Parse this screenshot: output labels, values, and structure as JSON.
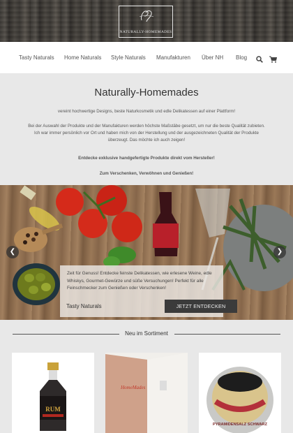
{
  "logo": {
    "text": "NATURALLY-HOMEMADES"
  },
  "nav": {
    "items": [
      "Tasty Naturals",
      "Home Naturals",
      "Style Naturals",
      "Manufakturen",
      "Über NH",
      "Blog"
    ],
    "search_icon": "search-icon",
    "cart_icon": "cart-icon"
  },
  "intro": {
    "title": "Naturally-Homemades",
    "line1": "vereint hochwertige Designs, beste Naturkosmetik und edle Delikatessen auf einer Plattform!",
    "line2": "Bei der Auswahl der Produkte und der Manufakturen werden höchste Maßstäbe gesetzt, um nur die beste Qualität zubieten.",
    "line3": "Ich war immer persönlich vor Ort und haben mich von der Herstellung und der ausgezeichneten Qualität der Produkte",
    "line4": "überzeugt. Das möchte ich auch zeigen!",
    "bold1": "Entdecke exklusive handgefertigte Produkte direkt vom Hersteller!",
    "bold2": "Zum Verschenken, Verwöhnen und Genießen!"
  },
  "hero": {
    "caption": "Zeit für Genuss! Entdecke feinste Delikatessen, wie erlesene Weine, edle Whiskys, Gourmet-Gewürze und süße Versuchungen! Perfekt für alle Feinschmecker zum Genießen oder Verschenken!",
    "category": "Tasty Naturals",
    "button": "JETZT ENTDECKEN",
    "prev_icon": "chevron-left-icon",
    "next_icon": "chevron-right-icon"
  },
  "new_section": {
    "title": "Neu im Sortiment",
    "products": [
      {
        "label": "RUM"
      },
      {
        "label": "HomeMades"
      },
      {
        "label": "PYRAMIDENSALZ SCHWARZ"
      }
    ]
  }
}
